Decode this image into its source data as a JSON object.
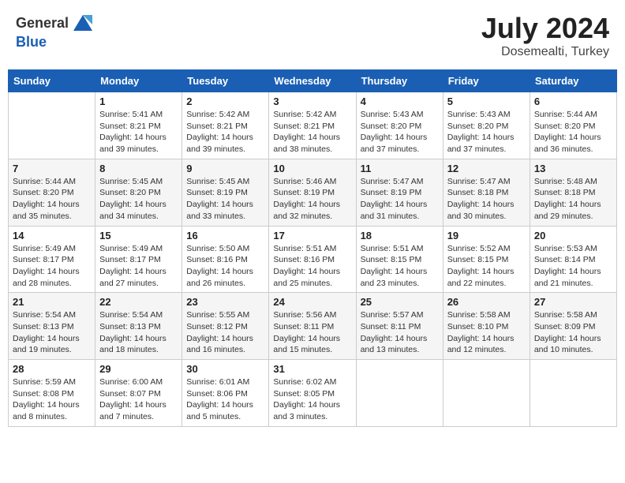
{
  "header": {
    "logo_general": "General",
    "logo_blue": "Blue",
    "title": "July 2024",
    "subtitle": "Dosemealti, Turkey"
  },
  "days_of_week": [
    "Sunday",
    "Monday",
    "Tuesday",
    "Wednesday",
    "Thursday",
    "Friday",
    "Saturday"
  ],
  "weeks": [
    [
      {
        "day": "",
        "info": ""
      },
      {
        "day": "1",
        "info": "Sunrise: 5:41 AM\nSunset: 8:21 PM\nDaylight: 14 hours\nand 39 minutes."
      },
      {
        "day": "2",
        "info": "Sunrise: 5:42 AM\nSunset: 8:21 PM\nDaylight: 14 hours\nand 39 minutes."
      },
      {
        "day": "3",
        "info": "Sunrise: 5:42 AM\nSunset: 8:21 PM\nDaylight: 14 hours\nand 38 minutes."
      },
      {
        "day": "4",
        "info": "Sunrise: 5:43 AM\nSunset: 8:20 PM\nDaylight: 14 hours\nand 37 minutes."
      },
      {
        "day": "5",
        "info": "Sunrise: 5:43 AM\nSunset: 8:20 PM\nDaylight: 14 hours\nand 37 minutes."
      },
      {
        "day": "6",
        "info": "Sunrise: 5:44 AM\nSunset: 8:20 PM\nDaylight: 14 hours\nand 36 minutes."
      }
    ],
    [
      {
        "day": "7",
        "info": "Sunrise: 5:44 AM\nSunset: 8:20 PM\nDaylight: 14 hours\nand 35 minutes."
      },
      {
        "day": "8",
        "info": "Sunrise: 5:45 AM\nSunset: 8:20 PM\nDaylight: 14 hours\nand 34 minutes."
      },
      {
        "day": "9",
        "info": "Sunrise: 5:45 AM\nSunset: 8:19 PM\nDaylight: 14 hours\nand 33 minutes."
      },
      {
        "day": "10",
        "info": "Sunrise: 5:46 AM\nSunset: 8:19 PM\nDaylight: 14 hours\nand 32 minutes."
      },
      {
        "day": "11",
        "info": "Sunrise: 5:47 AM\nSunset: 8:19 PM\nDaylight: 14 hours\nand 31 minutes."
      },
      {
        "day": "12",
        "info": "Sunrise: 5:47 AM\nSunset: 8:18 PM\nDaylight: 14 hours\nand 30 minutes."
      },
      {
        "day": "13",
        "info": "Sunrise: 5:48 AM\nSunset: 8:18 PM\nDaylight: 14 hours\nand 29 minutes."
      }
    ],
    [
      {
        "day": "14",
        "info": "Sunrise: 5:49 AM\nSunset: 8:17 PM\nDaylight: 14 hours\nand 28 minutes."
      },
      {
        "day": "15",
        "info": "Sunrise: 5:49 AM\nSunset: 8:17 PM\nDaylight: 14 hours\nand 27 minutes."
      },
      {
        "day": "16",
        "info": "Sunrise: 5:50 AM\nSunset: 8:16 PM\nDaylight: 14 hours\nand 26 minutes."
      },
      {
        "day": "17",
        "info": "Sunrise: 5:51 AM\nSunset: 8:16 PM\nDaylight: 14 hours\nand 25 minutes."
      },
      {
        "day": "18",
        "info": "Sunrise: 5:51 AM\nSunset: 8:15 PM\nDaylight: 14 hours\nand 23 minutes."
      },
      {
        "day": "19",
        "info": "Sunrise: 5:52 AM\nSunset: 8:15 PM\nDaylight: 14 hours\nand 22 minutes."
      },
      {
        "day": "20",
        "info": "Sunrise: 5:53 AM\nSunset: 8:14 PM\nDaylight: 14 hours\nand 21 minutes."
      }
    ],
    [
      {
        "day": "21",
        "info": "Sunrise: 5:54 AM\nSunset: 8:13 PM\nDaylight: 14 hours\nand 19 minutes."
      },
      {
        "day": "22",
        "info": "Sunrise: 5:54 AM\nSunset: 8:13 PM\nDaylight: 14 hours\nand 18 minutes."
      },
      {
        "day": "23",
        "info": "Sunrise: 5:55 AM\nSunset: 8:12 PM\nDaylight: 14 hours\nand 16 minutes."
      },
      {
        "day": "24",
        "info": "Sunrise: 5:56 AM\nSunset: 8:11 PM\nDaylight: 14 hours\nand 15 minutes."
      },
      {
        "day": "25",
        "info": "Sunrise: 5:57 AM\nSunset: 8:11 PM\nDaylight: 14 hours\nand 13 minutes."
      },
      {
        "day": "26",
        "info": "Sunrise: 5:58 AM\nSunset: 8:10 PM\nDaylight: 14 hours\nand 12 minutes."
      },
      {
        "day": "27",
        "info": "Sunrise: 5:58 AM\nSunset: 8:09 PM\nDaylight: 14 hours\nand 10 minutes."
      }
    ],
    [
      {
        "day": "28",
        "info": "Sunrise: 5:59 AM\nSunset: 8:08 PM\nDaylight: 14 hours\nand 8 minutes."
      },
      {
        "day": "29",
        "info": "Sunrise: 6:00 AM\nSunset: 8:07 PM\nDaylight: 14 hours\nand 7 minutes."
      },
      {
        "day": "30",
        "info": "Sunrise: 6:01 AM\nSunset: 8:06 PM\nDaylight: 14 hours\nand 5 minutes."
      },
      {
        "day": "31",
        "info": "Sunrise: 6:02 AM\nSunset: 8:05 PM\nDaylight: 14 hours\nand 3 minutes."
      },
      {
        "day": "",
        "info": ""
      },
      {
        "day": "",
        "info": ""
      },
      {
        "day": "",
        "info": ""
      }
    ]
  ]
}
